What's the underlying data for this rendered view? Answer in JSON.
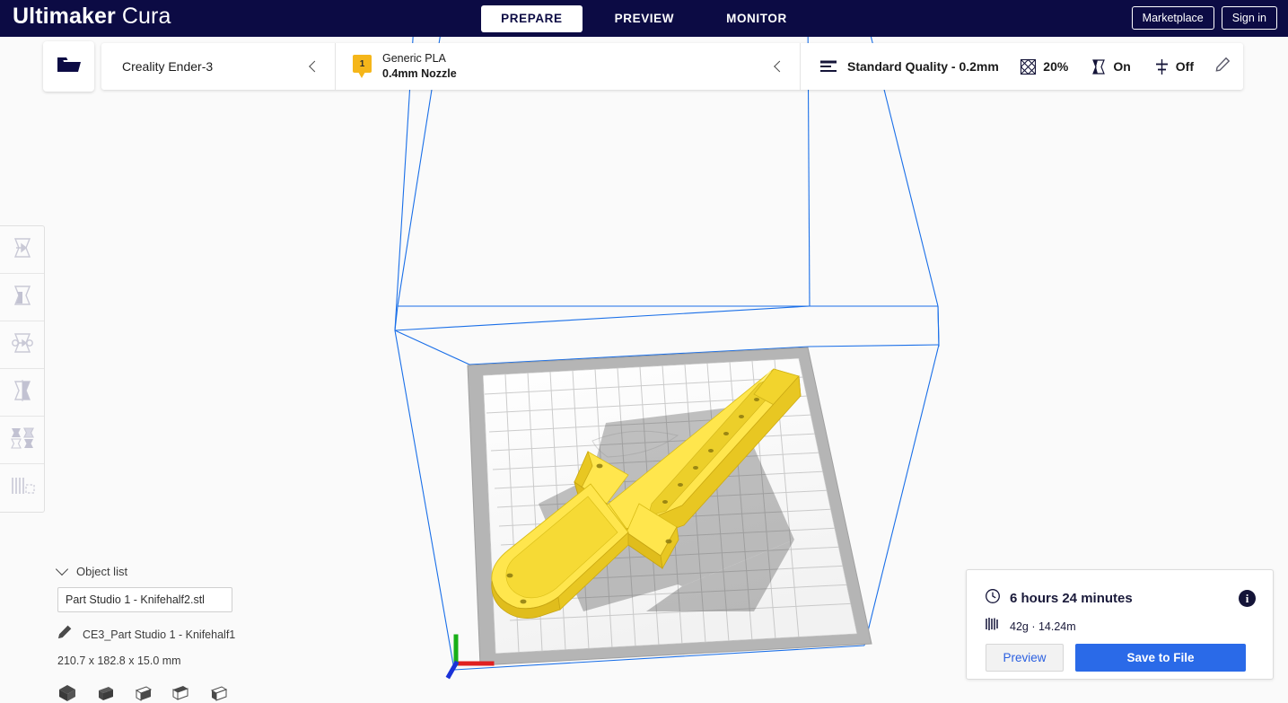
{
  "app": {
    "brand_bold": "Ultimaker",
    "brand_light": "Cura"
  },
  "header": {
    "tabs": [
      {
        "label": "PREPARE",
        "active": true
      },
      {
        "label": "PREVIEW",
        "active": false
      },
      {
        "label": "MONITOR",
        "active": false
      }
    ],
    "marketplace_label": "Marketplace",
    "signin_label": "Sign in"
  },
  "toolbar": {
    "open_file_icon": "open-folder-icon",
    "printer": {
      "name": "Creality Ender-3",
      "collapse_icon": "chevron-left-icon"
    },
    "material": {
      "extruder_number": "1",
      "name": "Generic PLA",
      "nozzle": "0.4mm Nozzle",
      "collapse_icon": "chevron-left-icon"
    },
    "profile": {
      "icon": "layers-icon",
      "name": "Standard Quality - 0.2mm"
    },
    "settings": [
      {
        "name": "infill",
        "icon": "infill-icon",
        "value": "20%"
      },
      {
        "name": "support",
        "icon": "support-icon",
        "value": "On"
      },
      {
        "name": "adhesion",
        "icon": "adhesion-icon",
        "value": "Off"
      }
    ],
    "edit_icon": "pencil-icon"
  },
  "left_tools": [
    {
      "name": "move-tool",
      "icon": "move-icon"
    },
    {
      "name": "scale-tool",
      "icon": "scale-icon"
    },
    {
      "name": "rotate-tool",
      "icon": "rotate-icon"
    },
    {
      "name": "mirror-tool",
      "icon": "mirror-icon"
    },
    {
      "name": "per-model-settings-tool",
      "icon": "per-model-settings-icon"
    },
    {
      "name": "support-blocker-tool",
      "icon": "support-blocker-icon"
    }
  ],
  "object_list": {
    "header_label": "Object list",
    "collapse_icon": "chevron-down-icon",
    "selected_object": "Part Studio 1 - Knifehalf2.stl",
    "file_icon": "pencil-icon",
    "file_name": "CE3_Part Studio 1 - Knifehalf1",
    "dimensions": "210.7 x 182.8 x 15.0 mm",
    "view_buttons": [
      {
        "name": "view-3d",
        "icon": "cube-3d-icon"
      },
      {
        "name": "view-front",
        "icon": "cube-front-icon"
      },
      {
        "name": "view-top",
        "icon": "cube-top-icon"
      },
      {
        "name": "view-left",
        "icon": "cube-left-icon"
      },
      {
        "name": "view-right",
        "icon": "cube-right-icon"
      }
    ]
  },
  "print_info": {
    "time_icon": "clock-icon",
    "time": "6 hours 24 minutes",
    "info_icon": "info-icon",
    "info_glyph": "i",
    "material_icon": "filament-icon",
    "material": "42g · 14.24m",
    "preview_label": "Preview",
    "save_label": "Save to File"
  },
  "viewport": {
    "model_color": "#f5d437",
    "build_volume_line_color": "#1a6fe8",
    "plate_color": "#b3b3b3",
    "axis": {
      "x": "#e02020",
      "y": "#18b018",
      "z": "#1a32d8"
    }
  }
}
